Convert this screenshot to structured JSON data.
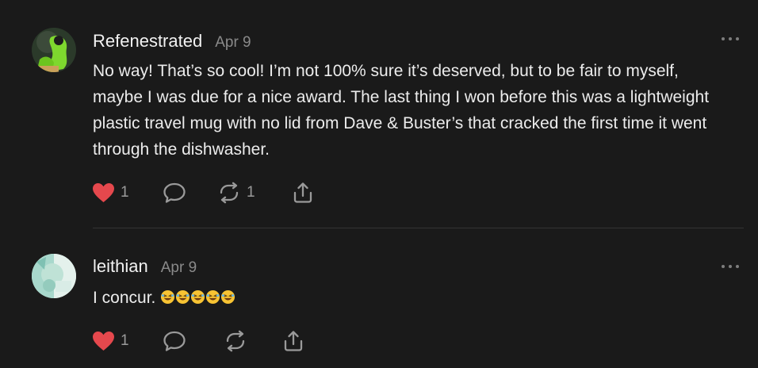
{
  "comments": [
    {
      "author": "Refenestrated",
      "date": "Apr 9",
      "text": "No way! That’s so cool! I’m not 100% sure it’s deserved, but to be fair to myself, maybe I was due for a nice award. The last thing I won before this was a lightweight plastic travel mug with no lid from Dave & Buster’s that cracked the first time it went through the dishwasher.",
      "likes": "1",
      "restacks": "1",
      "icons": [
        "heart-icon",
        "comment-icon",
        "restack-icon",
        "share-icon",
        "more-icon"
      ]
    },
    {
      "author": "leithian",
      "date": "Apr 9",
      "text": "I concur. ",
      "emoji": [
        "rofl-emoji",
        "rofl-emoji",
        "rofl-emoji",
        "rofl-emoji",
        "rofl-emoji"
      ],
      "likes": "1",
      "restacks": "",
      "icons": [
        "heart-icon",
        "comment-icon",
        "restack-icon",
        "share-icon",
        "more-icon"
      ]
    }
  ],
  "colors": {
    "background": "#1a1a1a",
    "text": "#ececec",
    "muted": "#8a8a8a",
    "heart": "#e5484d",
    "divider": "#333333"
  }
}
